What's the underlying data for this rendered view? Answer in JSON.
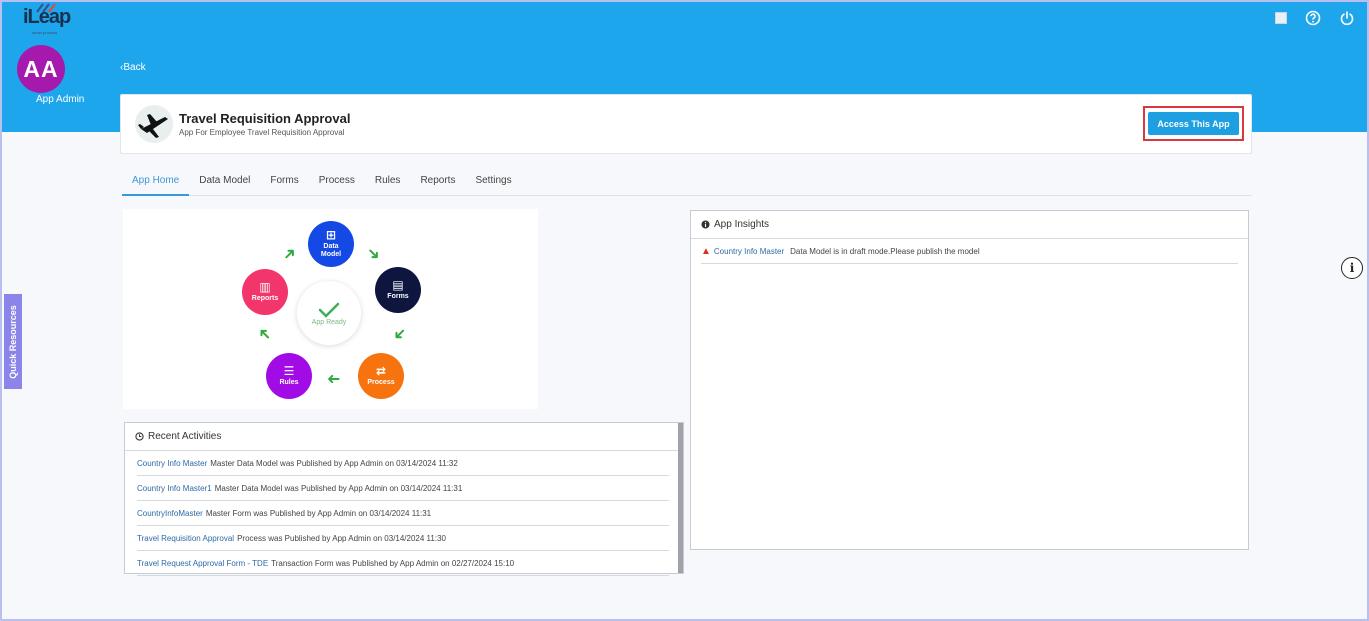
{
  "brand": {
    "name": "iLeap",
    "tagline": "smart process"
  },
  "user": {
    "initials": "AA",
    "name": "App Admin",
    "avatar_color": "#a519ad"
  },
  "header": {
    "back_label": "Back",
    "bg_color": "#1ea6ec"
  },
  "top_icons": [
    "broken-image-icon",
    "help-icon",
    "power-icon"
  ],
  "app": {
    "title": "Travel Requisition Approval",
    "subtitle": "App For Employee Travel Requisition Approval",
    "access_label": "Access This App"
  },
  "tabs": [
    "App Home",
    "Data Model",
    "Forms",
    "Process",
    "Rules",
    "Reports",
    "Settings"
  ],
  "active_tab": "App Home",
  "diagram": {
    "center": "App Ready",
    "nodes": {
      "data_model": "Data Model",
      "forms": "Forms",
      "process": "Process",
      "rules": "Rules",
      "reports": "Reports"
    }
  },
  "activities": {
    "title": "Recent Activities",
    "rows": [
      {
        "link": "Country Info Master",
        "text": "Master Data Model was Published by App Admin on 03/14/2024 11:32"
      },
      {
        "link": "Country Info Master1",
        "text": "Master Data Model was Published by App Admin on 03/14/2024 11:31"
      },
      {
        "link": "CountryInfoMaster",
        "text": "Master Form was Published by App Admin on 03/14/2024 11:31"
      },
      {
        "link": "Travel Requisition Approval",
        "text": "Process was Published by App Admin on 03/14/2024 11:30"
      },
      {
        "link": "Travel Request Approval Form - TDE",
        "text": "Transaction Form was Published by App Admin on 02/27/2024 15:10"
      }
    ]
  },
  "insights": {
    "title": "App Insights",
    "rows": [
      {
        "link": "Country Info Master",
        "text": "Data Model is in draft mode.Please publish the model"
      }
    ]
  },
  "quick_resources_label": "Quick Resources",
  "info_fab_label": "i"
}
